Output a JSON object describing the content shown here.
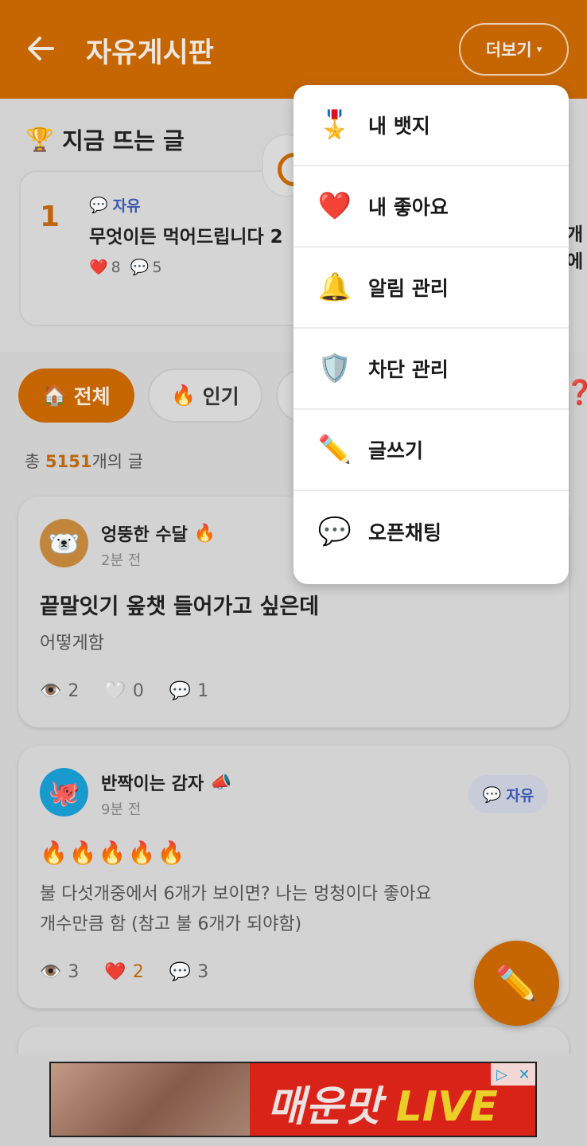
{
  "header": {
    "title": "자유게시판",
    "more_label": "더보기",
    "more_caret": "▾"
  },
  "trending": {
    "title": "지금 뜨는 글",
    "card": {
      "rank": "1",
      "category": "자유",
      "text": "무엇이든 먹어드립니다 2",
      "likes": "8",
      "comments": "5"
    },
    "edge_text": "개에"
  },
  "filters": {
    "all": "전체",
    "hot": "인기"
  },
  "total": {
    "prefix": "총 ",
    "count": "5151",
    "suffix": "개의 글"
  },
  "posts": [
    {
      "author": "엉뚱한 수달",
      "time": "2분 전",
      "title": "끝말잇기 옾챗 들어가고 싶은데",
      "body": "어떻게함",
      "views": "2",
      "likes": "0",
      "comments": "1"
    },
    {
      "author": "반짝이는 감자",
      "time": "9분 전",
      "category": "자유",
      "body_line1": "불 다섯개중에서 6개가 보이면? 나는 멍청이다 좋아요",
      "body_line2": "개수만큼 함 (참고 불 6개가 되야함)",
      "views": "3",
      "likes": "2",
      "comments": "3"
    }
  ],
  "menu": {
    "items": [
      {
        "label": "내 뱃지",
        "icon": "medal-icon"
      },
      {
        "label": "내 좋아요",
        "icon": "heart-icon"
      },
      {
        "label": "알림 관리",
        "icon": "bell-icon"
      },
      {
        "label": "차단 관리",
        "icon": "shield-icon"
      },
      {
        "label": "글쓰기",
        "icon": "pencil-icon"
      },
      {
        "label": "오픈채팅",
        "icon": "speech-bubble-icon"
      }
    ]
  },
  "ad": {
    "text": "매운맛 ",
    "text_highlight": "LIVE"
  },
  "colors": {
    "brand": "#cc6a04",
    "category": "#3d5bb8"
  }
}
